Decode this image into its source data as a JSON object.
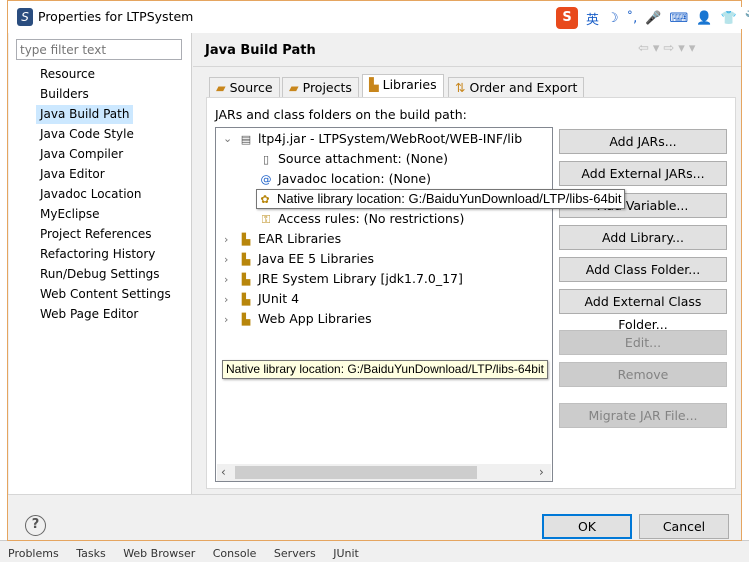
{
  "window": {
    "title": "Properties for LTPSystem"
  },
  "ime": {
    "logo": "S",
    "items": [
      "英",
      "☽",
      "˚,",
      "🎤",
      "⌨",
      "👤",
      "👕",
      "🔧"
    ]
  },
  "filter": {
    "placeholder": "type filter text"
  },
  "nav": {
    "items": [
      "Resource",
      "Builders",
      "Java Build Path",
      "Java Code Style",
      "Java Compiler",
      "Java Editor",
      "Javadoc Location",
      "MyEclipse",
      "Project References",
      "Refactoring History",
      "Run/Debug Settings",
      "Web Content Settings",
      "Web Page Editor"
    ],
    "selected": "Java Build Path"
  },
  "header": {
    "title": "Java Build Path",
    "nav": "⇦▾⇨▾▾"
  },
  "tabs": [
    {
      "label": "Source",
      "icon": "source-folder-icon"
    },
    {
      "label": "Projects",
      "icon": "projects-icon"
    },
    {
      "label": "Libraries",
      "icon": "library-icon"
    },
    {
      "label": "Order and Export",
      "icon": "order-icon"
    }
  ],
  "active_tab": "Libraries",
  "panel": {
    "label": "JARs and class folders on the build path:"
  },
  "tree": {
    "jar": "ltp4j.jar - LTPSystem/WebRoot/WEB-INF/lib",
    "children": [
      "Source attachment: (None)",
      "Javadoc location: (None)",
      "Native library location: G:/BaiduYunDownload/LTP/libs-64bit",
      "Access rules: (No restrictions)"
    ],
    "libraries": [
      "EAR Libraries",
      "Java EE 5 Libraries",
      "JRE System Library [jdk1.7.0_17]",
      "JUnit 4",
      "Web App Libraries"
    ]
  },
  "tooltip": "Native library location: G:/BaiduYunDownload/LTP/libs-64bit",
  "buttons": {
    "add_jars": "Add JARs...",
    "add_external_jars": "Add External JARs...",
    "add_variable": "Add Variable...",
    "add_library": "Add Library...",
    "add_class_folder": "Add Class Folder...",
    "add_external_class_folder": "Add External Class Folder...",
    "edit": "Edit...",
    "remove": "Remove",
    "migrate": "Migrate JAR File..."
  },
  "footer": {
    "help": "?",
    "ok": "OK",
    "cancel": "Cancel"
  },
  "background_tabs": [
    "Problems",
    "Tasks",
    "Web Browser",
    "Console",
    "Servers",
    "JUnit"
  ],
  "colors": {
    "selection": "#cce8ff",
    "default_button_border": "#0078d7",
    "dialog_border": "#e5a560"
  }
}
